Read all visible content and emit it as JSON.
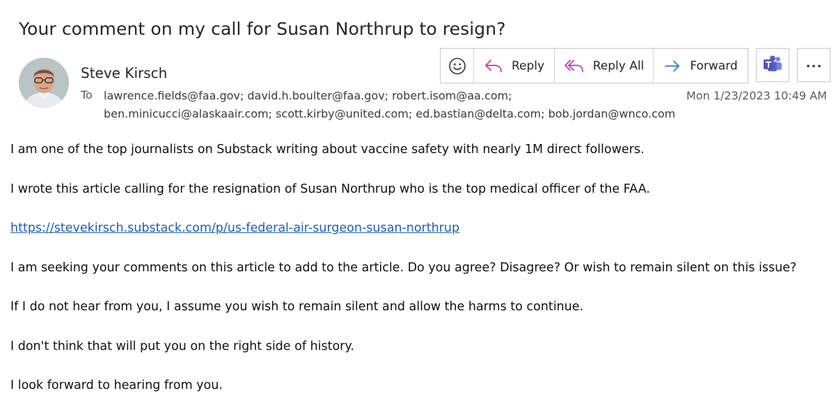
{
  "email": {
    "subject": "Your comment on my call for Susan Northrup to resign?",
    "sender_name": "Steve Kirsch",
    "to_label": "To",
    "recipients": "lawrence.fields@faa.gov; david.h.boulter@faa.gov; robert.isom@aa.com; ben.minicucci@alaskaair.com; scott.kirby@united.com; ed.bastian@delta.com; bob.jordan@wnco.com",
    "datetime": "Mon 1/23/2023 10:49 AM"
  },
  "toolbar": {
    "emoji_icon": "smiley-icon",
    "reply_label": "Reply",
    "reply_all_label": "Reply All",
    "forward_label": "Forward",
    "teams_icon": "teams-icon",
    "more_icon": "more-icon"
  },
  "body": {
    "p1": "I am one of the top journalists on Substack writing about vaccine safety with nearly 1M direct followers.",
    "p2": "I wrote this article calling for the resignation of Susan Northrup who is the top medical officer of the FAA.",
    "link": "https://stevekirsch.substack.com/p/us-federal-air-surgeon-susan-northrup",
    "p3": "I am seeking your comments on this article to add to the article. Do you agree? Disagree? Or wish to remain silent on this issue?",
    "p4": "If I do not hear from you, I assume you wish to remain silent and allow the harms to continue.",
    "p5": "I don't think that will put you on the right side of history.",
    "p6": "I look forward to hearing from you."
  },
  "colors": {
    "reply_arrow": "#c239b3",
    "forward_arrow": "#2b7cd3",
    "link": "#1b5fb4",
    "teams": "#5b5fc7"
  }
}
